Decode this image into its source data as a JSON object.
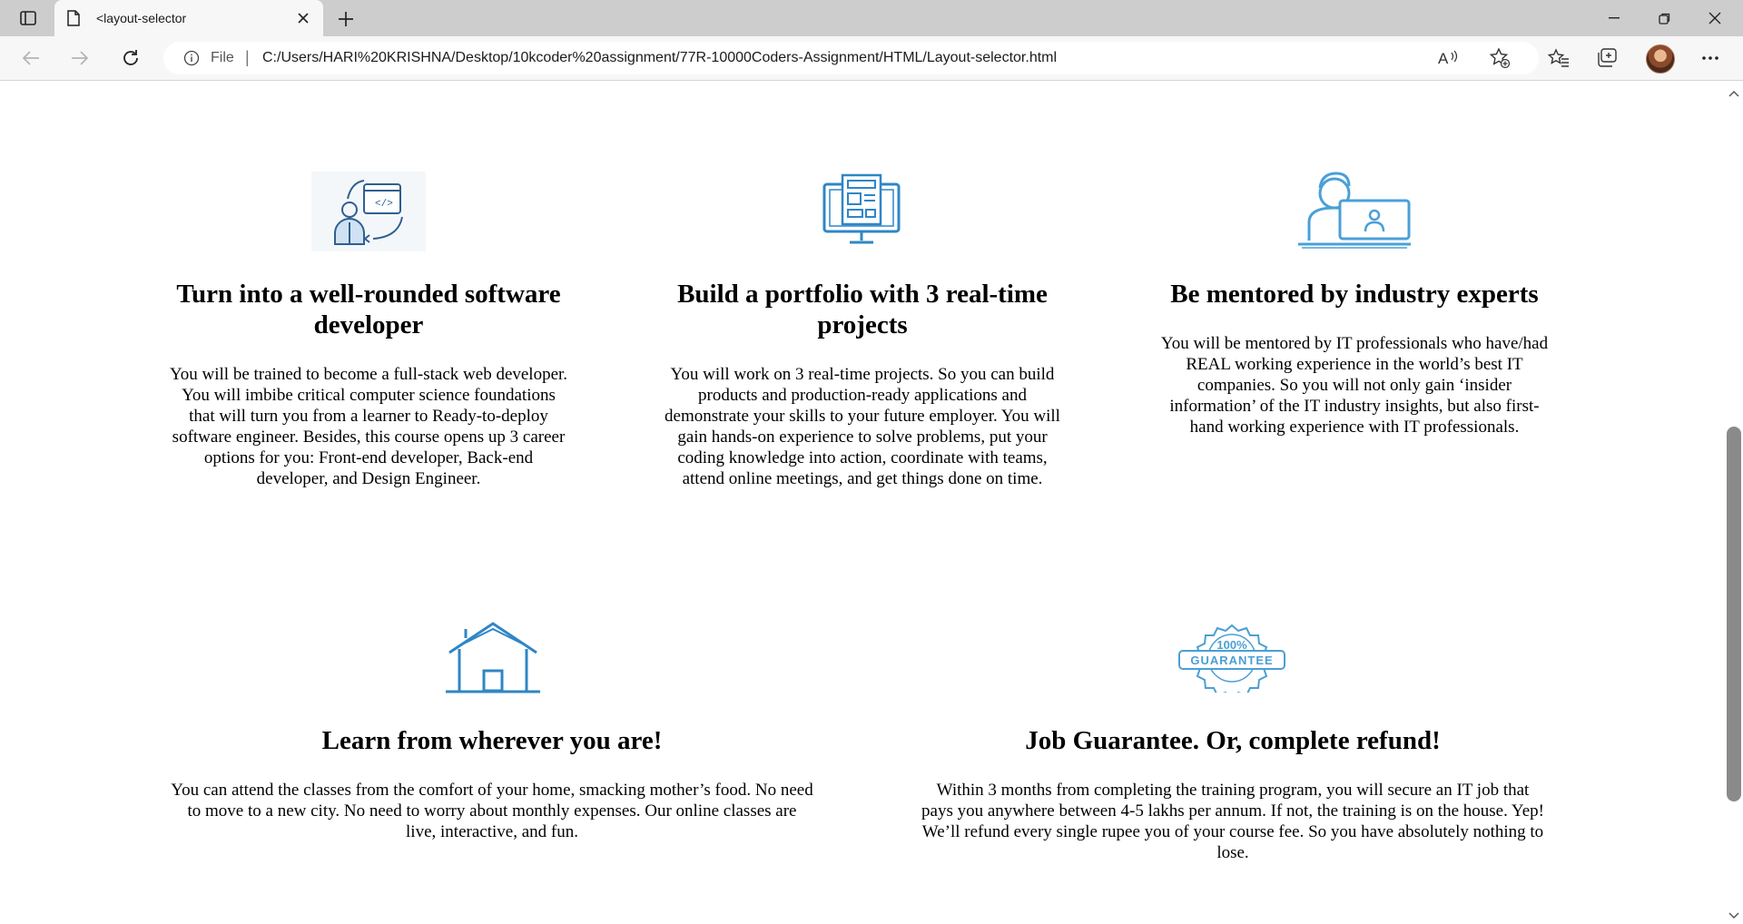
{
  "browser": {
    "tab_title": "<layout-selector",
    "address_scheme": "File",
    "address_url": "C:/Users/HARI%20KRISHNA/Desktop/10kcoder%20assignment/77R-10000Coders-Assignment/HTML/Layout-selector.html",
    "icons": [
      "tab-actions-icon",
      "page-icon",
      "close-icon",
      "plus-icon",
      "minimize-icon",
      "restore-icon",
      "close-window-icon",
      "back-icon",
      "forward-icon",
      "refresh-icon",
      "info-icon",
      "read-aloud-icon",
      "add-favorite-icon",
      "favorites-icon",
      "collections-icon",
      "profile-avatar",
      "more-icon"
    ]
  },
  "features": [
    {
      "icon": "developer-code-icon",
      "title": "Turn into a well-rounded software developer",
      "body": "You will be trained to become a full-stack web developer. You will imbibe critical computer science foundations that will turn you from a learner to Ready-to-deploy software engineer. Besides, this course opens up 3 career options for you: Front-end developer, Back-end developer, and Design Engineer."
    },
    {
      "icon": "monitor-portfolio-icon",
      "title": "Build a portfolio with 3 real-time projects",
      "body": "You will work on 3 real-time projects. So you can build products and production-ready applications and demonstrate your skills to your future employer. You will gain hands-on experience to solve problems, put your coding knowledge into action, coordinate with teams, attend online meetings, and get things done on time."
    },
    {
      "icon": "mentor-computer-icon",
      "title": "Be mentored by industry experts",
      "body": "You will be mentored by IT professionals who have/had REAL working experience in the world’s best IT companies. So you will not only gain ‘insider information’ of the IT industry insights, but also first-hand working experience with IT professionals."
    },
    {
      "icon": "house-icon",
      "title": "Learn from wherever you are!",
      "body": "You can attend the classes from the comfort of your home, smacking mother’s food. No need to move to a new city. No need to worry about monthly expenses. Our online classes are live, interactive, and fun."
    },
    {
      "icon": "guarantee-badge-icon",
      "title": "Job Guarantee. Or, complete refund!",
      "body": "Within 3 months from completing the training program, you will secure an IT job that pays you anywhere between 4-5 lakhs per annum. If not, the training is on the house. Yep! We’ll refund every single rupee you of your course fee. So you have absolutely nothing to lose.",
      "badge_top": "100%",
      "badge_bottom": "GUARANTEE"
    }
  ],
  "colors": {
    "icon_blue": "#2f86c6",
    "text": "#000000"
  }
}
